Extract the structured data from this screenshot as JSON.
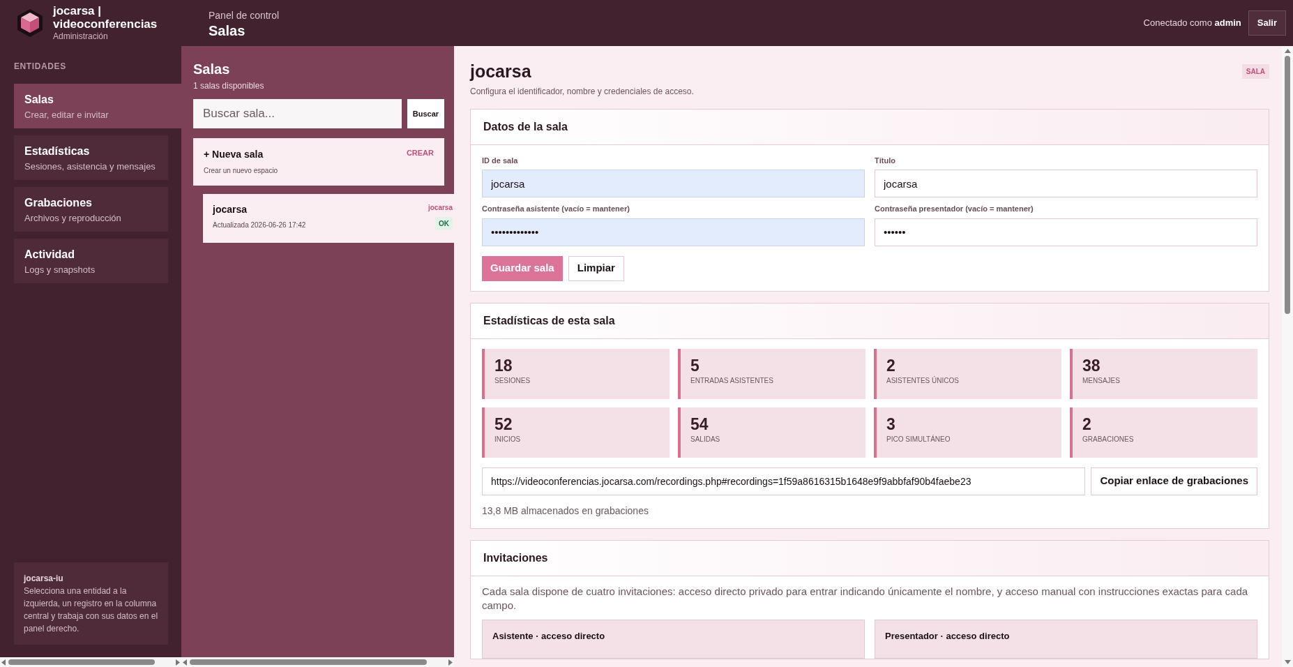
{
  "header": {
    "brand_title": "jocarsa | videoconferencias",
    "brand_subtitle": "Administración",
    "breadcrumb": "Panel de control",
    "page_title": "Salas",
    "user_prefix": "Conectado como",
    "user": "admin",
    "logout": "Salir"
  },
  "sidebar": {
    "heading": "ENTIDADES",
    "items": [
      {
        "title": "Salas",
        "subtitle": "Crear, editar e invitar",
        "selected": true
      },
      {
        "title": "Estadísticas",
        "subtitle": "Sesiones, asistencia y mensajes",
        "selected": false
      },
      {
        "title": "Grabaciones",
        "subtitle": "Archivos y reproducción",
        "selected": false
      },
      {
        "title": "Actividad",
        "subtitle": "Logs y snapshots",
        "selected": false
      }
    ],
    "info": {
      "title": "jocarsa-iu",
      "text": "Selecciona una entidad a la izquierda, un registro en la columna central y trabaja con sus datos en el panel derecho."
    }
  },
  "list": {
    "title": "Salas",
    "count": "1 salas disponibles",
    "search": {
      "placeholder": "Buscar sala...",
      "button": "Buscar"
    },
    "new_item": {
      "title": "+ Nueva sala",
      "action": "CREAR",
      "subtitle": "Crear un nuevo espacio"
    },
    "rooms": [
      {
        "name": "jocarsa",
        "updated": "Actualizada 2026-06-26 17:42",
        "tag": "jocarsa",
        "status": "OK"
      }
    ]
  },
  "detail": {
    "title": "jocarsa",
    "subtitle": "Configura el identificador, nombre y credenciales de acceso.",
    "badge": "SALA",
    "room_form": {
      "title": "Datos de la sala",
      "fields": [
        {
          "label": "ID de sala",
          "value": "jocarsa",
          "autofilled": true
        },
        {
          "label": "Título",
          "value": "jocarsa",
          "autofilled": false
        },
        {
          "label": "Contraseña asistente (vacío = mantener)",
          "value": "•••••••••••••",
          "autofilled": true
        },
        {
          "label": "Contraseña presentador (vacío = mantener)",
          "value": "••••••",
          "autofilled": false
        }
      ],
      "buttons": [
        {
          "label": "Guardar sala",
          "kind": "primary"
        },
        {
          "label": "Limpiar",
          "kind": "secondary"
        }
      ]
    },
    "stats": {
      "title": "Estadísticas de esta sala",
      "items": [
        {
          "value": "18",
          "label": "SESIONES"
        },
        {
          "value": "5",
          "label": "ENTRADAS ASISTENTES"
        },
        {
          "value": "2",
          "label": "ASISTENTES ÚNICOS"
        },
        {
          "value": "38",
          "label": "MENSAJES"
        },
        {
          "value": "52",
          "label": "INICIOS"
        },
        {
          "value": "54",
          "label": "SALIDAS"
        },
        {
          "value": "3",
          "label": "PICO SIMULTÁNEO"
        },
        {
          "value": "2",
          "label": "GRABACIONES"
        }
      ],
      "link": "https://videoconferencias.jocarsa.com/recordings.php#recordings=1f59a8616315b1648e9f9abbfaf90b4faebe23",
      "copy_button": "Copiar enlace de grabaciones",
      "storage": "13,8 MB almacenados en grabaciones"
    },
    "invitations": {
      "title": "Invitaciones",
      "text": "Cada sala dispone de cuatro invitaciones: acceso directo privado para entrar indicando únicamente el nombre, y acceso manual con instrucciones exactas para cada campo.",
      "cards": [
        {
          "title": "Asistente · acceso directo"
        },
        {
          "title": "Presentador · acceso directo"
        }
      ]
    }
  }
}
